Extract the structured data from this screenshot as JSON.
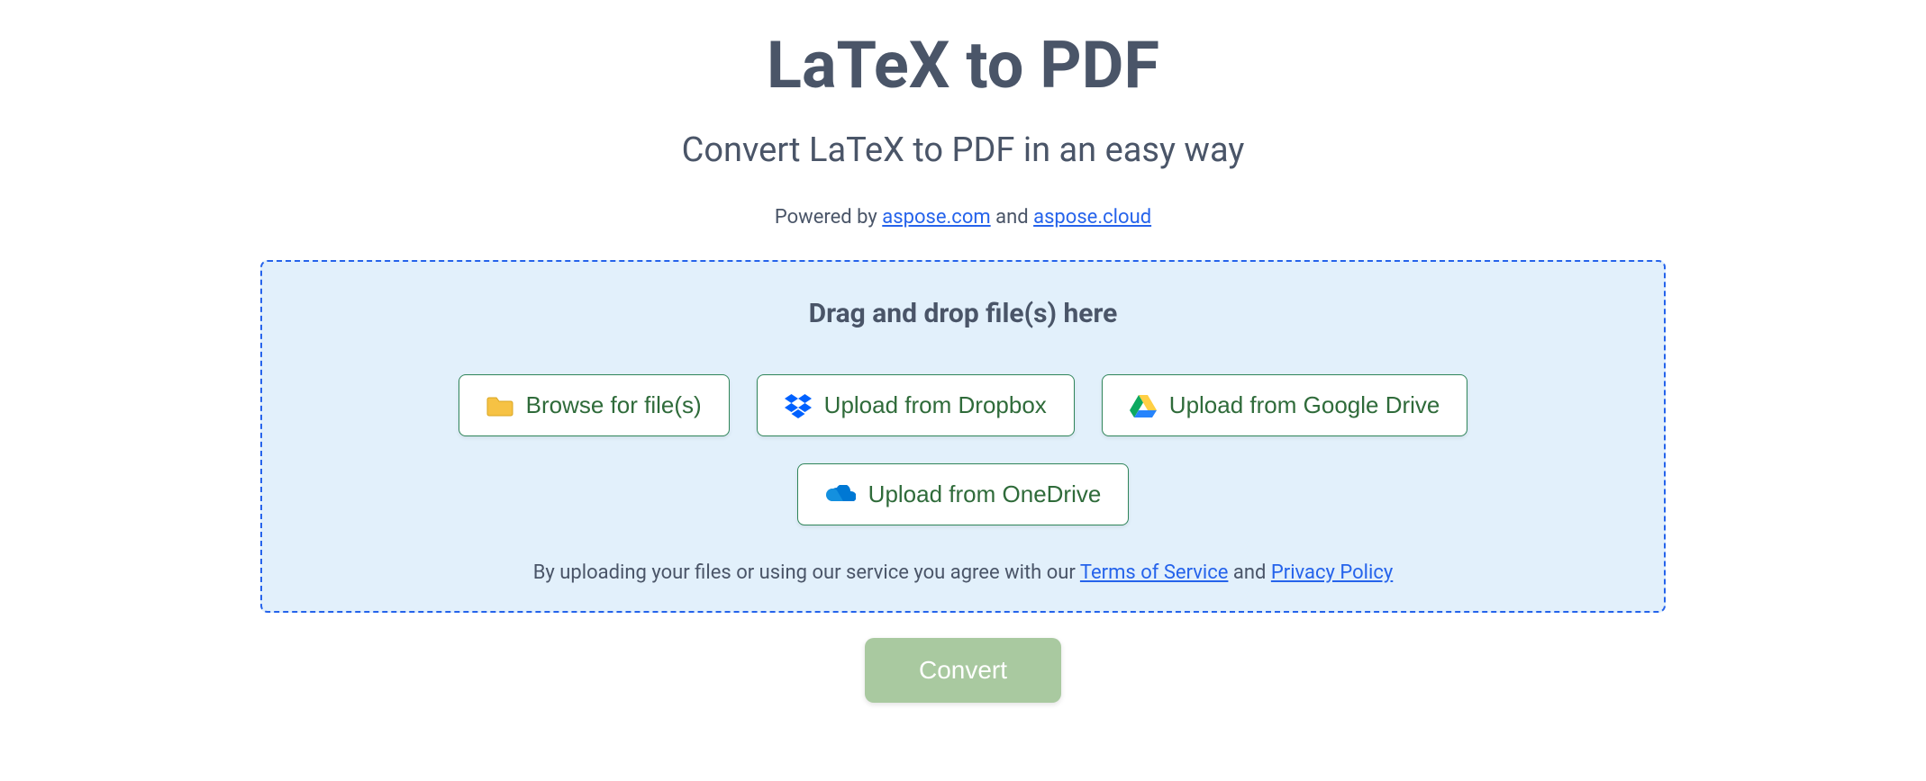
{
  "header": {
    "title": "LaTeX to PDF",
    "subtitle": "Convert LaTeX to PDF in an easy way"
  },
  "powered": {
    "prefix": "Powered by ",
    "link1": "aspose.com",
    "middle": " and ",
    "link2": "aspose.cloud"
  },
  "dropzone": {
    "title": "Drag and drop file(s) here",
    "buttons": {
      "browse": "Browse for file(s)",
      "dropbox": "Upload from Dropbox",
      "gdrive": "Upload from Google Drive",
      "onedrive": "Upload from OneDrive"
    },
    "terms": {
      "prefix": "By uploading your files or using our service you agree with our ",
      "link1": "Terms of Service",
      "middle": " and ",
      "link2": "Privacy Policy"
    }
  },
  "actions": {
    "convert": "Convert"
  }
}
